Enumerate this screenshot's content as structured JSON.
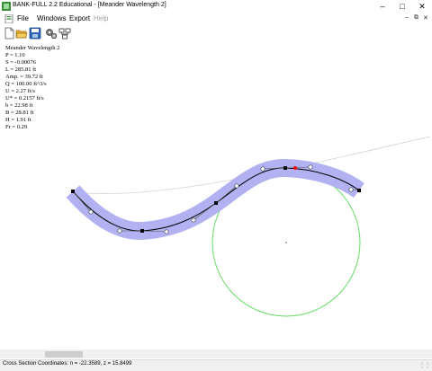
{
  "window": {
    "title": "BANK-FULL 2.2 Educational - [Meander Wavelength 2]"
  },
  "menu": {
    "file": "File",
    "windows": "Windows",
    "export": "Export",
    "help": "Help"
  },
  "toolbar": {
    "new_icon": "new-document-icon",
    "open_icon": "open-folder-icon",
    "save_icon": "save-disk-icon",
    "settings_icon": "gears-icon",
    "network_icon": "network-icon"
  },
  "info": {
    "title": "Meander Wavelength 2",
    "lines": [
      "P = 1.10",
      "S = -0.00076",
      "L = 285.81 ft",
      "Amp. = 39.72 ft",
      "Q = 100.00 ft^3/s",
      "U = 2.27 ft/s",
      "U* = 0.2157 ft/s",
      "b = 22.98 ft",
      "B = 28.81 ft",
      "H = 1.91 ft",
      "Fr = 0.29"
    ]
  },
  "status": {
    "text": "Cross Section Coordinates: n = -22.3589, z = 15.8499"
  },
  "colors": {
    "channel_fill": "#b2b2f2",
    "circle": "#66dd66",
    "centerline": "#000000",
    "highlight": "#ff0000",
    "background": "#ffffff"
  }
}
